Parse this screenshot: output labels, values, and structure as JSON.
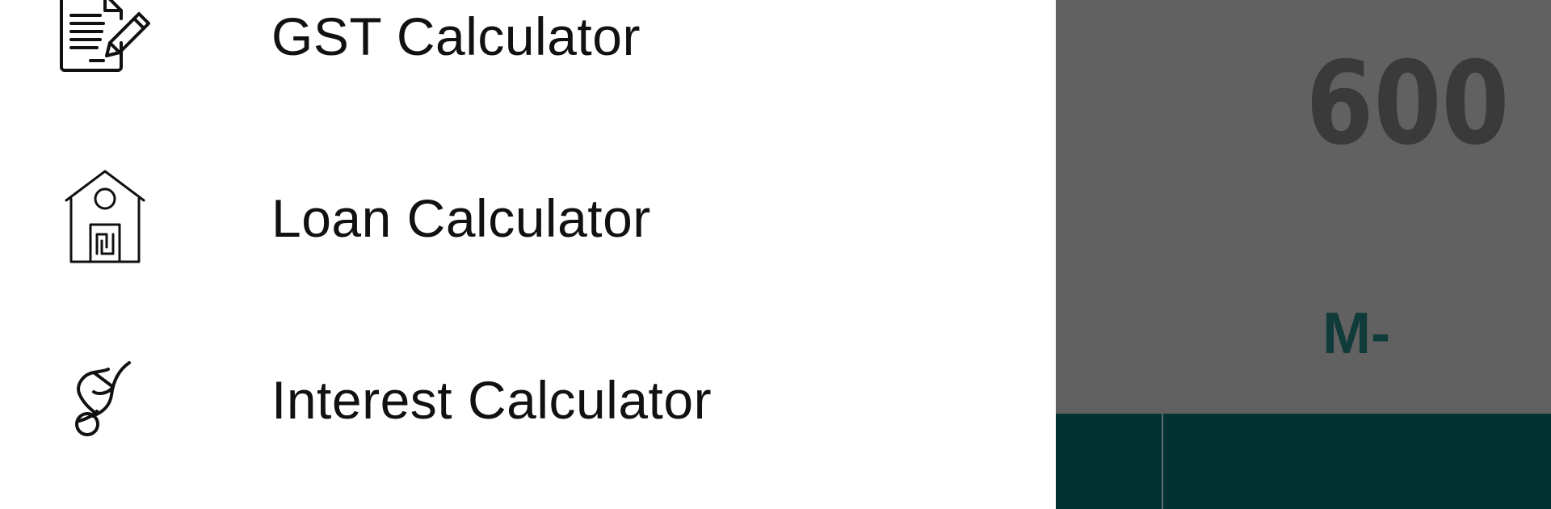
{
  "drawer": {
    "items": [
      {
        "label": "GST Calculator",
        "icon": "gst-document-pen-icon"
      },
      {
        "label": "Loan Calculator",
        "icon": "loan-house-icon"
      },
      {
        "label": "Interest Calculator",
        "icon": "interest-hand-coin-icon"
      }
    ]
  },
  "calculator": {
    "display": "600",
    "memory_key": "M-"
  },
  "colors": {
    "drawer_bg": "#ffffff",
    "menu_text": "#111111",
    "calc_bg": "#616161",
    "display_text": "#3a3a3a",
    "memory_key_text": "#0f3b3a",
    "keypad_bg": "#033232"
  }
}
